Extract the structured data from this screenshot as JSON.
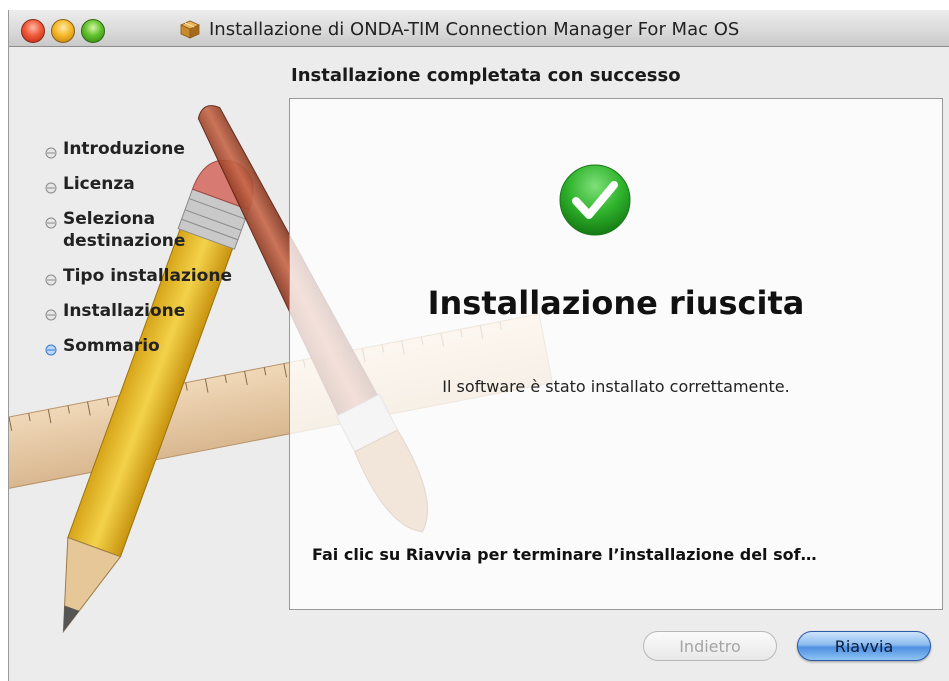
{
  "window": {
    "title": "Installazione di ONDA-TIM Connection Manager For Mac OS"
  },
  "page": {
    "heading": "Installazione completata con successo"
  },
  "steps": [
    {
      "label": "Introduzione",
      "active": false
    },
    {
      "label": "Licenza",
      "active": false
    },
    {
      "label": "Seleziona\ndestinazione",
      "active": false
    },
    {
      "label": "Tipo installazione",
      "active": false
    },
    {
      "label": "Installazione",
      "active": false
    },
    {
      "label": "Sommario",
      "active": true
    }
  ],
  "result": {
    "title": "Installazione riuscita",
    "message": "Il software è stato installato correttamente.",
    "restart_hint": "Fai clic su Riavvia per terminare l’installazione del sof…"
  },
  "buttons": {
    "back_label": "Indietro",
    "restart_label": "Riavvia"
  },
  "colors": {
    "success_green": "#2fb32c",
    "accent_blue": "#4e8fe0"
  }
}
